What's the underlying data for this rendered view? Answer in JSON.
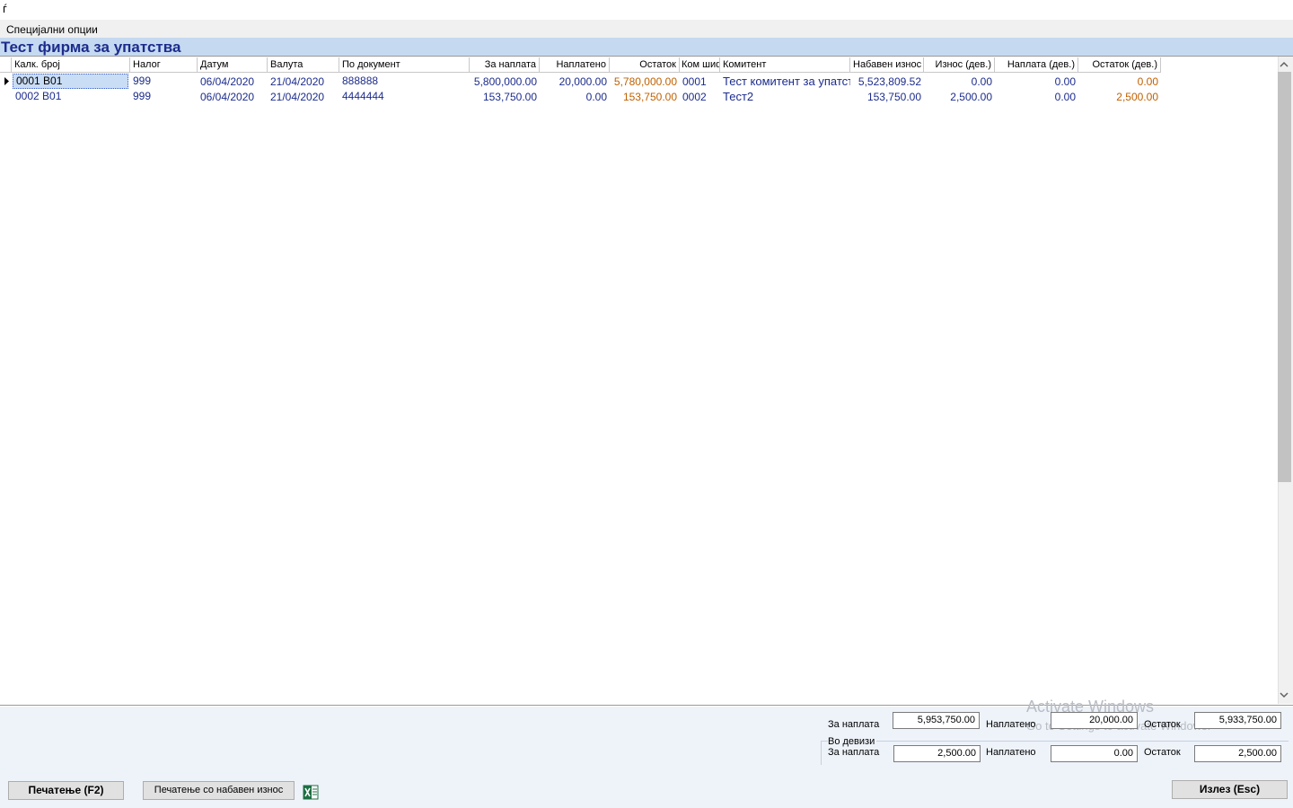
{
  "window": {
    "title": "ѓ"
  },
  "menu": {
    "special_options": "Специјални опции"
  },
  "company": {
    "name": "Тест фирма за упатства"
  },
  "grid": {
    "columns": [
      "Калк. број",
      "Налог",
      "Датум",
      "Валута",
      "По документ",
      "За наплата",
      "Наплатено",
      "Остаток",
      "Ком шиф",
      "Комитент",
      "Набавен износ",
      "Износ (дев.)",
      "Наплата (дев.)",
      "Остаток (дев.)"
    ],
    "rows": [
      {
        "calc_no": "0001   B01",
        "order": "999",
        "date": "06/04/2020",
        "due": "21/04/2020",
        "document": "888888",
        "to_pay": "5,800,000.00",
        "paid": "20,000.00",
        "balance": "5,780,000.00",
        "client_code": "0001",
        "client": "Тест комитент за упатства",
        "purchase": "5,523,809.52",
        "amount_fx": "0.00",
        "paid_fx": "0.00",
        "balance_fx": "0.00"
      },
      {
        "calc_no": "0002   B01",
        "order": "999",
        "date": "06/04/2020",
        "due": "21/04/2020",
        "document": "4444444",
        "to_pay": "153,750.00",
        "paid": "0.00",
        "balance": "153,750.00",
        "client_code": "0002",
        "client": "Тест2",
        "purchase": "153,750.00",
        "amount_fx": "2,500.00",
        "paid_fx": "0.00",
        "balance_fx": "2,500.00"
      }
    ],
    "balance_color": "#c06000"
  },
  "totals": {
    "to_pay_label": "За наплата",
    "to_pay": "5,953,750.00",
    "paid_label": "Наплатено",
    "paid": "20,000.00",
    "balance_label": "Остаток",
    "balance": "5,933,750.00",
    "fx_group_label": "Во девизи",
    "fx_to_pay_label": "За наплата",
    "fx_to_pay": "2,500.00",
    "fx_paid_label": "Наплатено",
    "fx_paid": "0.00",
    "fx_balance_label": "Остаток",
    "fx_balance": "2,500.00"
  },
  "buttons": {
    "print": "Печатење (F2)",
    "print_purchase": "Печатење со набавен износ",
    "excel_icon": "excel-export-icon",
    "exit": "Излез (Esc)"
  },
  "watermark": {
    "line1": "Activate Windows",
    "line2": "Go to Settings to activate Windows."
  }
}
